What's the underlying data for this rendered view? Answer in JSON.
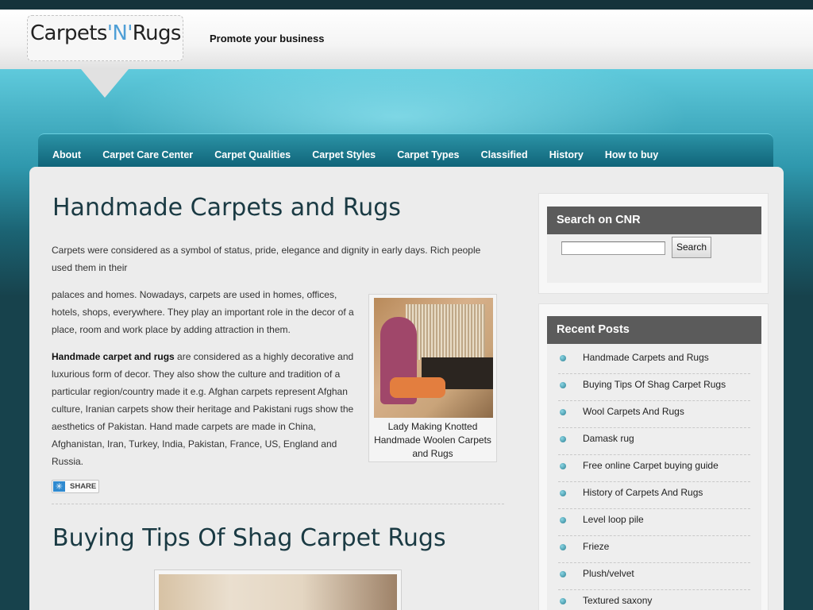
{
  "header": {
    "logo_parts": [
      "Carpets",
      "'N'",
      "Rugs"
    ],
    "tagline": "Promote your business"
  },
  "nav": {
    "items": [
      "About",
      "Carpet Care Center",
      "Carpet Qualities",
      "Carpet Styles",
      "Carpet Types",
      "Classified",
      "History",
      "How to buy"
    ]
  },
  "posts": [
    {
      "title": "Handmade Carpets and Rugs",
      "intro": "Carpets were considered as a symbol of status, pride, elegance and dignity in early days. Rich people used them in their",
      "para1": "palaces and homes. Nowadays, carpets are used in homes, offices, hotels, shops, everywhere. They play an important role in the decor of a place, room and work place by adding attraction in them.",
      "para2_bold": "Handmade carpet and rugs",
      "para2_rest": " are considered as a highly decorative and luxurious form of decor. They also show the culture and tradition of a particular region/country made it e.g. Afghan carpets represent Afghan culture, Iranian carpets show their heritage and Pakistani rugs show the aesthetics of Pakistan. Hand made carpets are made in China, Afghanistan, Iran, Turkey, India, Pakistan, France, US, England and Russia.",
      "image_caption": "Lady Making Knotted Handmade Woolen Carpets and Rugs",
      "share_label": "SHARE"
    },
    {
      "title": "Buying Tips Of Shag Carpet Rugs"
    }
  ],
  "sidebar": {
    "search": {
      "title": "Search on CNR",
      "button_label": "Search",
      "input_value": ""
    },
    "recent_posts": {
      "title": "Recent Posts",
      "items": [
        "Handmade Carpets and Rugs",
        "Buying Tips Of Shag Carpet Rugs",
        "Wool Carpets And Rugs",
        "Damask rug",
        "Free online Carpet buying guide",
        "History of Carpets And Rugs",
        "Level loop pile",
        "Frieze",
        "Plush/velvet",
        "Textured saxony"
      ]
    }
  }
}
